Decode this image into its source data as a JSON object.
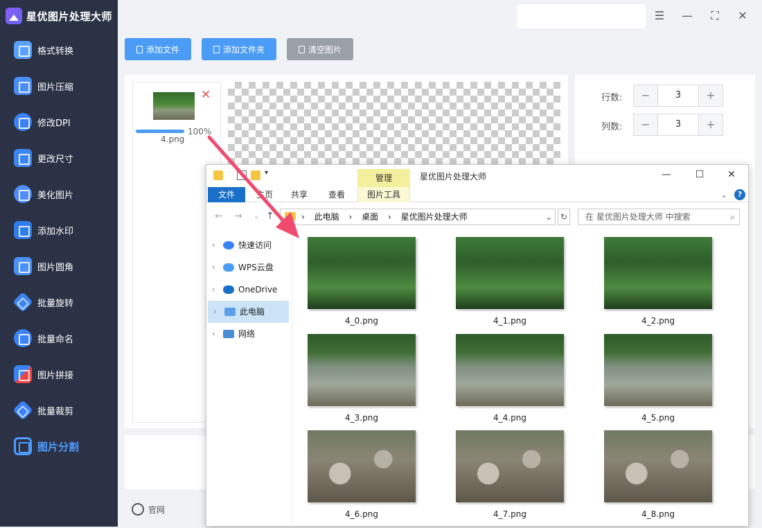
{
  "app": {
    "title": "星优图片处理大师"
  },
  "sidebar": {
    "items": [
      {
        "label": "格式转换"
      },
      {
        "label": "图片压缩"
      },
      {
        "label": "修改DPI"
      },
      {
        "label": "更改尺寸"
      },
      {
        "label": "美化图片"
      },
      {
        "label": "添加水印"
      },
      {
        "label": "图片圆角"
      },
      {
        "label": "批量旋转"
      },
      {
        "label": "批量命名"
      },
      {
        "label": "图片拼接"
      },
      {
        "label": "批量裁剪"
      },
      {
        "label": "图片分割"
      }
    ],
    "active": "图片分割"
  },
  "toolbar": {
    "add_file": "添加文件",
    "add_folder": "添加文件夹",
    "clear": "清空图片"
  },
  "file_list": {
    "items": [
      {
        "name": "4.png",
        "progress_label": "100%",
        "progress": 1.0
      }
    ]
  },
  "settings": {
    "rows_label": "行数:",
    "rows_value": "3",
    "cols_label": "列数:",
    "cols_value": "3",
    "minus": "−",
    "plus": "+"
  },
  "footer": {
    "website": "官网"
  },
  "explorer": {
    "title": "星优图片处理大师",
    "manage_tab": "管理",
    "ribbon_tabs": [
      "文件",
      "主页",
      "共享",
      "查看",
      "图片工具"
    ],
    "breadcrumb": [
      "此电脑",
      "桌面",
      "星优图片处理大师"
    ],
    "search_placeholder": "在 星优图片处理大师 中搜索",
    "nav_items": [
      "快速访问",
      "WPS云盘",
      "OneDrive",
      "此电脑",
      "网络"
    ],
    "selected_nav": "此电脑",
    "files": [
      "4_0.png",
      "4_1.png",
      "4_2.png",
      "4_3.png",
      "4_4.png",
      "4_5.png",
      "4_6.png",
      "4_7.png",
      "4_8.png"
    ]
  },
  "colors": {
    "sidebar_bg": "#2b3245",
    "accent": "#4a9cf6",
    "active_text": "#4d9cff",
    "manage_tab": "#f3ef9c",
    "file_tab": "#1a6fc8",
    "arrow": "#f04a6e"
  }
}
